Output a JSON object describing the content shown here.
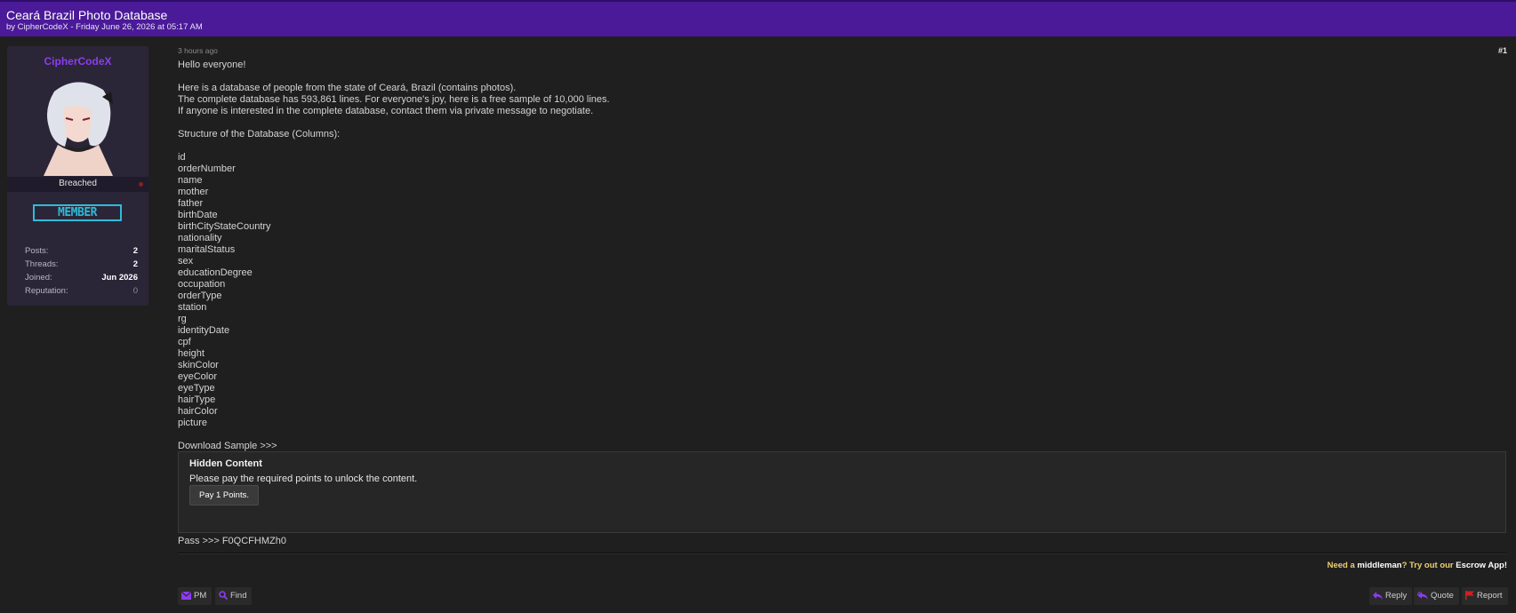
{
  "thread": {
    "title": "Ceará Brazil Photo Database",
    "subtitle": "by CipherCodeX - Friday June 26, 2026 at 05:17 AM"
  },
  "user": {
    "name": "CipherCodeX",
    "group_title": "Breached",
    "badge": "MEMBER",
    "stats": [
      {
        "label": "Posts:",
        "value": "2"
      },
      {
        "label": "Threads:",
        "value": "2"
      },
      {
        "label": "Joined:",
        "value": "Jun 2026"
      },
      {
        "label": "Reputation:",
        "value": "0"
      }
    ]
  },
  "post": {
    "time": "3 hours ago",
    "number": "#1",
    "greeting": "Hello everyone!",
    "intro_1": "Here is a database of people from the state of Ceará, Brazil (contains photos).",
    "intro_2": "The complete database has 593,861 lines. For everyone's joy, here is a free sample of 10,000 lines.",
    "intro_3": "If anyone is interested in the complete database, contact them via private message to negotiate.",
    "structure_heading": "Structure of the Database (Columns):",
    "columns": [
      "id",
      "orderNumber",
      "name",
      "mother",
      "father",
      "birthDate",
      "birthCityStateCountry",
      "nationality",
      "maritalStatus",
      "sex",
      "educationDegree",
      "occupation",
      "orderType",
      "station",
      "rg",
      "identityDate",
      "cpf",
      "height",
      "skinColor",
      "eyeColor",
      "eyeType",
      "hairType",
      "hairColor",
      "picture"
    ],
    "download_label": "Download Sample >>>",
    "hidden": {
      "title": "Hidden Content",
      "description": "Please pay the required points to unlock the content.",
      "button": "Pay 1 Points."
    },
    "pass": "Pass >>> F0QCFHMZh0"
  },
  "signature": {
    "part1": "Need a ",
    "part2": "middleman",
    "part3": "? Try out our ",
    "part4": "Escrow App!"
  },
  "actions": {
    "pm": "PM",
    "find": "Find",
    "reply": "Reply",
    "quote": "Quote",
    "report": "Report"
  },
  "colors": {
    "header_bg": "#4a1a98",
    "username": "#8c3cf0",
    "badge": "#2dbcd8",
    "signature": "#f0d06a",
    "report_icon": "#d02020"
  }
}
